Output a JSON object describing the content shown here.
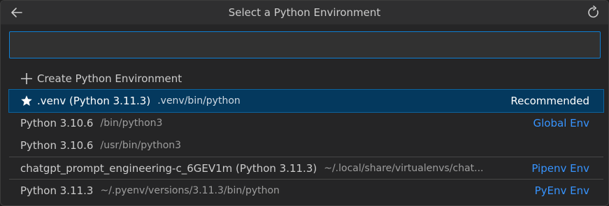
{
  "header": {
    "title": "Select a Python Environment",
    "back_icon": "arrow-left-icon",
    "refresh_icon": "refresh-icon"
  },
  "search": {
    "value": "",
    "placeholder": ""
  },
  "items": [
    {
      "icon": "plus-icon",
      "label": "Create Python Environment",
      "desc": "",
      "badge": ""
    },
    {
      "icon": "star-icon",
      "label": ".venv (Python 3.11.3)",
      "desc": ".venv/bin/python",
      "badge": "Recommended",
      "selected": true
    },
    {
      "icon": "",
      "label": "Python 3.10.6",
      "desc": "/bin/python3",
      "badge": "Global Env"
    },
    {
      "icon": "",
      "label": "Python 3.10.6",
      "desc": "/usr/bin/python3",
      "badge": ""
    },
    {
      "icon": "",
      "label": "chatgpt_prompt_engineering-c_6GEV1m (Python 3.11.3)",
      "desc": "~/.local/share/virtualenvs/chat...",
      "badge": "Pipenv Env"
    },
    {
      "icon": "",
      "label": "Python 3.11.3",
      "desc": "~/.pyenv/versions/3.11.3/bin/python",
      "badge": "PyEnv Env"
    }
  ],
  "colors": {
    "accent": "#0e7fd4",
    "selected_bg": "#04395e",
    "badge": "#3794ff"
  }
}
